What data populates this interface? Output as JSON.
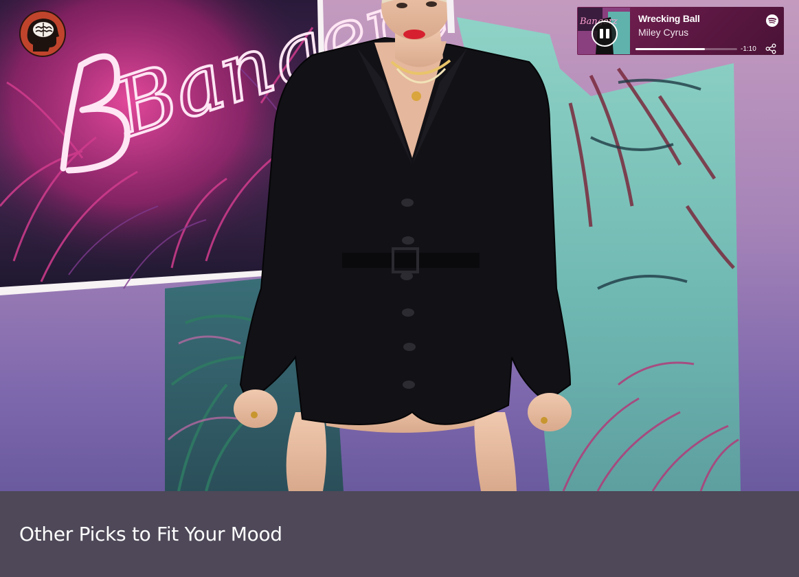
{
  "hero": {
    "neon_sign_text": "Bangerz",
    "colors": {
      "background_pink": "#c49bbf",
      "background_purple": "#7e68ad",
      "neon_pink": "#ff5fb4",
      "jacket_black": "#121116",
      "foliage_teal": "#57a3a2"
    }
  },
  "brand": {
    "icon": "brain-head-icon",
    "color": "#c0442c"
  },
  "player": {
    "title": "Wrecking Ball",
    "artist": "Miley Cyrus",
    "album_art_text": "Bangerz",
    "time_remaining": "-1:10",
    "progress": 0.68,
    "state": "playing",
    "control_icon": "pause-icon",
    "service_icon": "spotify-icon",
    "share_icon": "share-icon",
    "colors": {
      "background": "#6a1c4c",
      "text": "#ffffff"
    }
  },
  "caption": {
    "heading": "Other Picks to Fit Your Mood"
  }
}
